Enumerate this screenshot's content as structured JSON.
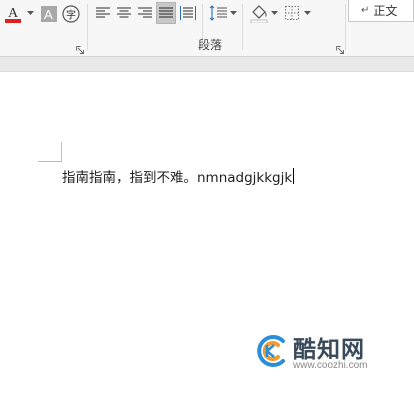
{
  "ribbon": {
    "font_color_letter": "A",
    "highlight_letter": "A",
    "enclose_char": "字",
    "paragraph_group_label": "段落",
    "style_normal_label": "正文",
    "style_mark": "↵"
  },
  "document": {
    "text": "指南指南，指到不难。nmnadgjkkgjk"
  },
  "watermark": {
    "title": "酷知网",
    "url": "www.coozhi.com"
  },
  "colors": {
    "font_color_bar": "#e02020",
    "highlight_bg": "#a8a8a8",
    "ribbon_bg": "#f7f7f7",
    "active_button_bg": "#c8c8c8",
    "watermark_blue": "#2a8fd8",
    "watermark_orange": "#f29a2e"
  }
}
